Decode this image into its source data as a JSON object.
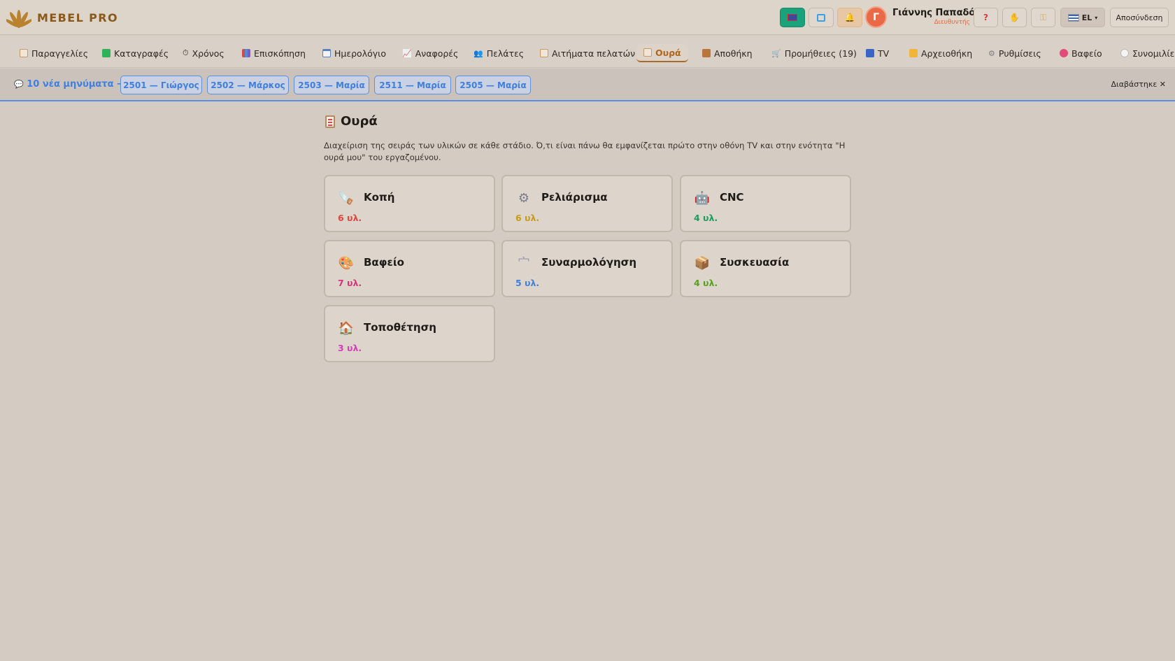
{
  "brand": {
    "name": "MEBEL PRO"
  },
  "user": {
    "initial": "Γ",
    "name": "Γιάννης Παπαδό...",
    "role": "Διευθυντής"
  },
  "header": {
    "help": "?",
    "language": "EL",
    "logout": "Αποσύνδεση"
  },
  "nav": {
    "items": [
      {
        "label": "Παραγγελίες"
      },
      {
        "label": "Καταγραφές"
      },
      {
        "label": "Χρόνος"
      },
      {
        "label": "Επισκόπηση"
      },
      {
        "label": "Ημερολόγιο"
      },
      {
        "label": "Αναφορές"
      },
      {
        "label": "Πελάτες"
      },
      {
        "label": "Αιτήματα πελατών"
      },
      {
        "label": "Ουρά"
      },
      {
        "label": "Αποθήκη"
      },
      {
        "label": "Προμήθειες (19)"
      },
      {
        "label": "TV"
      },
      {
        "label": "Αρχειοθήκη"
      },
      {
        "label": "Ρυθμίσεις"
      },
      {
        "label": "Βαφείο"
      },
      {
        "label": "Συνομιλίες"
      }
    ],
    "active": "Ουρά"
  },
  "messages": {
    "count_text": "10 νέα μηνύματα →",
    "chips": [
      "2501 — Γιώργος",
      "2502 — Μάρκος",
      "2503 — Μαρία",
      "2511 — Μαρία",
      "2505 — Μαρία"
    ],
    "dismiss": "Διαβάστηκε"
  },
  "page": {
    "title": "Ουρά",
    "description": "Διαχείριση της σειράς των υλικών σε κάθε στάδιο. Ό,τι είναι πάνω θα εμφανίζεται πρώτο στην οθόνη TV και στην ενότητα \"Η ουρά μου\" του εργαζομένου."
  },
  "stages": [
    {
      "name": "Κοπή",
      "count": "6 υλ.",
      "color": "#e0453a",
      "icon": "saw-icon"
    },
    {
      "name": "Ρελιάρισμα",
      "count": "6 υλ.",
      "color": "#c79a1a",
      "icon": "gear-icon"
    },
    {
      "name": "CNC",
      "count": "4 υλ.",
      "color": "#1f9a5e",
      "icon": "robot-icon"
    },
    {
      "name": "Βαφείο",
      "count": "7 υλ.",
      "color": "#d6337a",
      "icon": "palette-icon"
    },
    {
      "name": "Συναρμολόγηση",
      "count": "5 υλ.",
      "color": "#3f7fe0",
      "icon": "screwdriver-icon"
    },
    {
      "name": "Συσκευασία",
      "count": "4 υλ.",
      "color": "#5aa01f",
      "icon": "package-icon"
    },
    {
      "name": "Τοποθέτηση",
      "count": "3 υλ.",
      "color": "#d63bb8",
      "icon": "house-icon"
    }
  ]
}
